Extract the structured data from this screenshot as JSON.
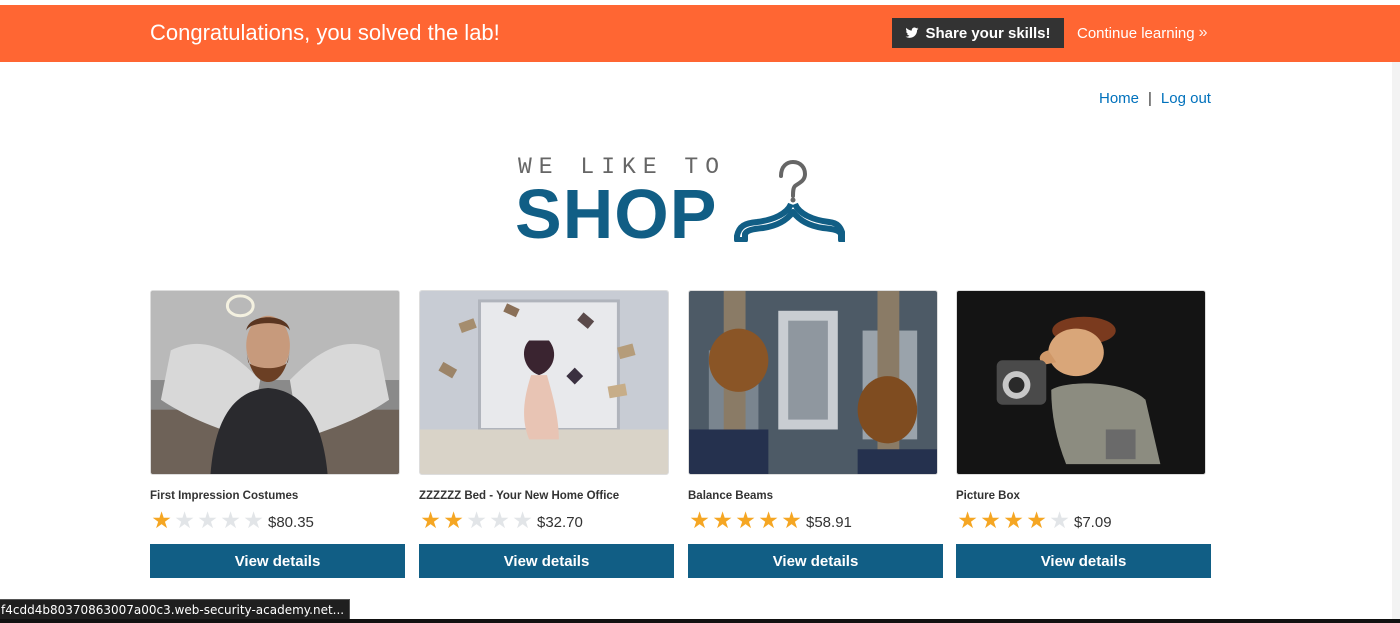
{
  "banner": {
    "title": "Congratulations, you solved the lab!",
    "share_label": "Share your skills!",
    "continue_label": "Continue learning",
    "color": "#ff6633"
  },
  "nav": {
    "home": "Home",
    "separator": "|",
    "logout": "Log out"
  },
  "logo": {
    "top_text": "WE LIKE TO",
    "main_text": "SHOP"
  },
  "products": [
    {
      "name": "First Impression Costumes",
      "rating": 1,
      "price": "$80.35",
      "button": "View details"
    },
    {
      "name": "ZZZZZZ Bed - Your New Home Office",
      "rating": 2,
      "price": "$32.70",
      "button": "View details"
    },
    {
      "name": "Balance Beams",
      "rating": 5,
      "price": "$58.91",
      "button": "View details"
    },
    {
      "name": "Picture Box",
      "rating": 4,
      "price": "$7.09",
      "button": "View details"
    }
  ],
  "status_bar": {
    "url": "f4cdd4b80370863007a00c3.web-security-academy.net..."
  },
  "colors": {
    "accent": "#115e85",
    "link": "#0071bc",
    "star": "#f5a623"
  }
}
